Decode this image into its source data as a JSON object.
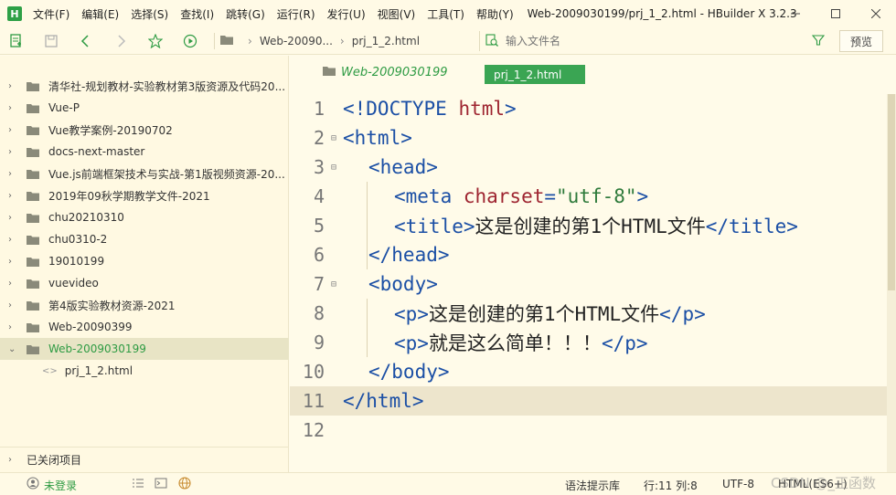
{
  "app": {
    "logo_letter": "H",
    "window_title": "Web-2009030199/prj_1_2.html - HBuilder X 3.2.3"
  },
  "menu": [
    "文件(F)",
    "编辑(E)",
    "选择(S)",
    "查找(I)",
    "跳转(G)",
    "运行(R)",
    "发行(U)",
    "视图(V)",
    "工具(T)",
    "帮助(Y)"
  ],
  "toolbar": {
    "breadcrumb_folder": "Web-20090...",
    "breadcrumb_file": "prj_1_2.html",
    "search_placeholder": "输入文件名",
    "preview_label": "预览"
  },
  "sidebar": {
    "items": [
      {
        "label": "清华社-规划教材-实验教材第3版资源及代码20...",
        "expanded": false
      },
      {
        "label": "Vue-P",
        "expanded": false
      },
      {
        "label": "Vue教学案例-20190702",
        "expanded": false
      },
      {
        "label": "docs-next-master",
        "expanded": false
      },
      {
        "label": "Vue.js前端框架技术与实战-第1版视频资源-20...",
        "expanded": false
      },
      {
        "label": "2019年09秋学期教学文件-2021",
        "expanded": false
      },
      {
        "label": "chu20210310",
        "expanded": false
      },
      {
        "label": "chu0310-2",
        "expanded": false
      },
      {
        "label": "19010199",
        "expanded": false
      },
      {
        "label": "vuevideo",
        "expanded": false
      },
      {
        "label": "第4版实验教材资源-2021",
        "expanded": false
      },
      {
        "label": "Web-20090399",
        "expanded": false
      },
      {
        "label": "Web-2009030199",
        "expanded": true,
        "selected": true
      }
    ],
    "file": {
      "label": "prj_1_2.html"
    },
    "closed_projects_label": "已关闭项目"
  },
  "editor": {
    "folder_tab": "Web-2009030199",
    "active_tab": "prj_1_2.html",
    "current_line": 11,
    "lines": [
      {
        "num": "1",
        "fold": "",
        "indent": 0,
        "tokens": [
          {
            "t": "tag",
            "v": "<!DOCTYPE "
          },
          {
            "t": "attr",
            "v": "html"
          },
          {
            "t": "tag",
            "v": ">"
          }
        ]
      },
      {
        "num": "2",
        "fold": "⊟",
        "indent": 0,
        "tokens": [
          {
            "t": "tag",
            "v": "<html>"
          }
        ]
      },
      {
        "num": "3",
        "fold": "⊟",
        "indent": 1,
        "tokens": [
          {
            "t": "tag",
            "v": "<head>"
          }
        ]
      },
      {
        "num": "4",
        "fold": "",
        "indent": 2,
        "tokens": [
          {
            "t": "tag",
            "v": "<meta "
          },
          {
            "t": "attr",
            "v": "charset"
          },
          {
            "t": "tag",
            "v": "="
          },
          {
            "t": "str",
            "v": "\"utf-8\""
          },
          {
            "t": "tag",
            "v": ">"
          }
        ]
      },
      {
        "num": "5",
        "fold": "",
        "indent": 2,
        "tokens": [
          {
            "t": "tag",
            "v": "<title>"
          },
          {
            "t": "txt",
            "v": "这是创建的第1个HTML文件"
          },
          {
            "t": "tag",
            "v": "</title>"
          }
        ]
      },
      {
        "num": "6",
        "fold": "",
        "indent": 1,
        "tokens": [
          {
            "t": "tag",
            "v": "</head>"
          }
        ]
      },
      {
        "num": "7",
        "fold": "⊟",
        "indent": 1,
        "tokens": [
          {
            "t": "tag",
            "v": "<body>"
          }
        ]
      },
      {
        "num": "8",
        "fold": "",
        "indent": 2,
        "tokens": [
          {
            "t": "tag",
            "v": "<p>"
          },
          {
            "t": "txt",
            "v": "这是创建的第1个HTML文件"
          },
          {
            "t": "tag",
            "v": "</p>"
          }
        ]
      },
      {
        "num": "9",
        "fold": "",
        "indent": 2,
        "tokens": [
          {
            "t": "tag",
            "v": "<p>"
          },
          {
            "t": "txt",
            "v": "就是这么简单！！！"
          },
          {
            "t": "tag",
            "v": "</p>"
          }
        ]
      },
      {
        "num": "10",
        "fold": "",
        "indent": 1,
        "tokens": [
          {
            "t": "tag",
            "v": "</body>"
          }
        ]
      },
      {
        "num": "11",
        "fold": "",
        "indent": 0,
        "tokens": [
          {
            "t": "tag",
            "v": "</html>"
          }
        ]
      },
      {
        "num": "12",
        "fold": "",
        "indent": 0,
        "tokens": []
      }
    ]
  },
  "status": {
    "login": "未登录",
    "syntax": "语法提示库",
    "position": "行:11  列:8",
    "encoding": "UTF-8",
    "language": "HTML(ES6+)",
    "watermark": "CSDN @_正函数"
  },
  "colors": {
    "accent": "#2e9b43",
    "tag": "#1b4fa5",
    "attr": "#9e2430",
    "string": "#2e7a3b",
    "background": "#fffbe9"
  }
}
